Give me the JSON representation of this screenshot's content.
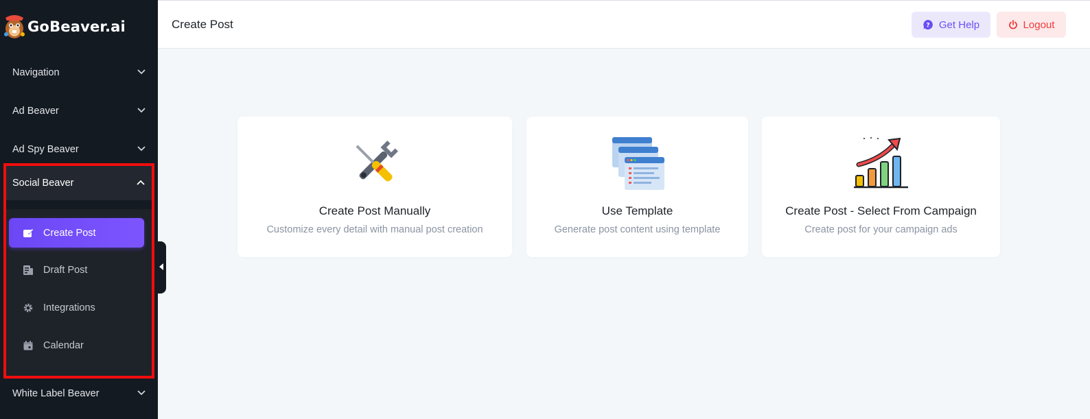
{
  "app": {
    "name": "GoBeaver.ai"
  },
  "sidebar": {
    "sections": [
      {
        "label": "Navigation"
      },
      {
        "label": "Ad Beaver"
      },
      {
        "label": "Ad Spy Beaver"
      }
    ],
    "social": {
      "label": "Social Beaver",
      "items": [
        {
          "label": "Create Post",
          "icon": "edit-post-icon"
        },
        {
          "label": "Draft Post",
          "icon": "draft-document-icon"
        },
        {
          "label": "Integrations",
          "icon": "gear-icon"
        },
        {
          "label": "Calendar",
          "icon": "calendar-icon"
        }
      ]
    },
    "bottom_section": {
      "label": "White Label Beaver"
    }
  },
  "header": {
    "title": "Create Post",
    "help_label": "Get Help",
    "logout_label": "Logout"
  },
  "cards": [
    {
      "title": "Create Post Manually",
      "description": "Customize every detail with manual post creation",
      "icon": "tools-icon"
    },
    {
      "title": "Use Template",
      "description": "Generate post content using template",
      "icon": "template-icon"
    },
    {
      "title": "Create Post - Select From Campaign",
      "description": "Create post for your campaign ads",
      "icon": "growth-chart-icon"
    }
  ],
  "colors": {
    "sidebar_bg": "#141a22",
    "accent": "#6b47f5",
    "highlight_border": "#f10d0d",
    "logout": "#ee3b3b",
    "help": "#6a4ff2"
  }
}
